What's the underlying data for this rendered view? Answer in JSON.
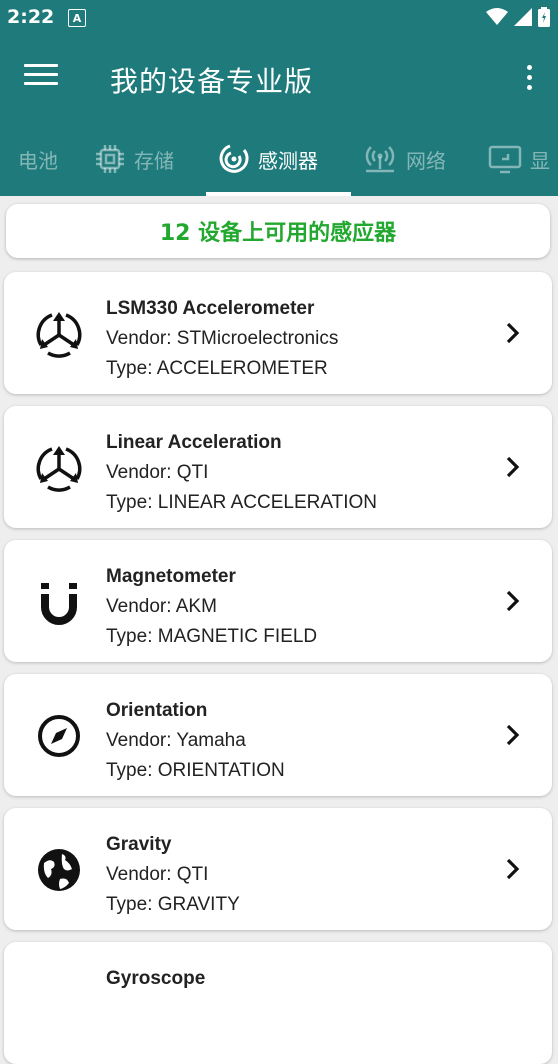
{
  "status": {
    "time": "2:22",
    "badge": "A"
  },
  "app": {
    "title": "我的设备专业版"
  },
  "tabs": [
    {
      "label": "电池"
    },
    {
      "label": "存储"
    },
    {
      "label": "感测器"
    },
    {
      "label": "网络"
    },
    {
      "label": "显"
    }
  ],
  "summary": "12 设备上可用的感应器",
  "sensors": [
    {
      "name": "LSM330 Accelerometer",
      "vendor": "Vendor: STMicroelectronics",
      "type": "Type: ACCELEROMETER",
      "icon": "accelerometer-icon"
    },
    {
      "name": "Linear Acceleration",
      "vendor": "Vendor: QTI",
      "type": "Type: LINEAR ACCELERATION",
      "icon": "accelerometer-icon"
    },
    {
      "name": "Magnetometer",
      "vendor": "Vendor: AKM",
      "type": "Type: MAGNETIC FIELD",
      "icon": "magnet-icon"
    },
    {
      "name": "Orientation",
      "vendor": "Vendor: Yamaha",
      "type": "Type: ORIENTATION",
      "icon": "compass-icon"
    },
    {
      "name": "Gravity",
      "vendor": "Vendor: QTI",
      "type": "Type: GRAVITY",
      "icon": "globe-icon"
    },
    {
      "name": "Gyroscope",
      "vendor": "",
      "type": "",
      "icon": "gyroscope-icon"
    }
  ],
  "colors": {
    "primary": "#1e7a7b",
    "accent_text": "#22a82e",
    "background": "#eeeeee"
  }
}
